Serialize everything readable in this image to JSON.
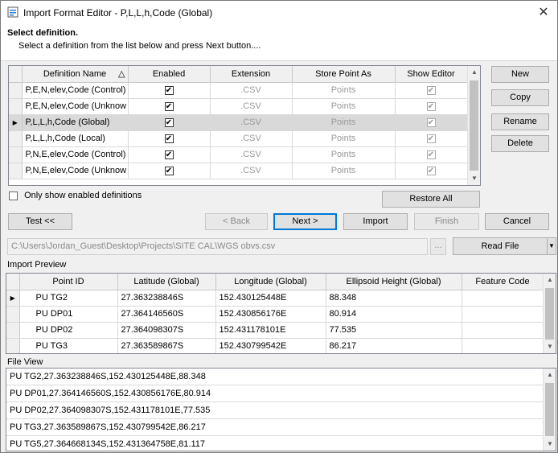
{
  "window": {
    "title": "Import Format Editor - P,L,L,h,Code (Global)",
    "close_glyph": "✕"
  },
  "header": {
    "title": "Select definition.",
    "subtitle": "Select a definition from the list below and press Next button...."
  },
  "definitions_grid": {
    "columns": [
      "Definition Name",
      "Enabled",
      "Extension",
      "Store Point As",
      "Show Editor"
    ],
    "sort_glyph": "△",
    "rows": [
      {
        "name": "P,E,N,elev,Code (Control)",
        "enabled": true,
        "extension": ".CSV",
        "store_as": "Points",
        "show_editor": true
      },
      {
        "name": "P,E,N,elev,Code (Unknow",
        "enabled": true,
        "extension": ".CSV",
        "store_as": "Points",
        "show_editor": true
      },
      {
        "name": "P,L,L,h,Code (Global)",
        "enabled": true,
        "extension": ".CSV",
        "store_as": "Points",
        "show_editor": true
      },
      {
        "name": "P,L,L,h,Code (Local)",
        "enabled": true,
        "extension": ".CSV",
        "store_as": "Points",
        "show_editor": true
      },
      {
        "name": "P,N,E,elev,Code (Control)",
        "enabled": true,
        "extension": ".CSV",
        "store_as": "Points",
        "show_editor": true
      },
      {
        "name": "P,N,E,elev,Code (Unknow",
        "enabled": true,
        "extension": ".CSV",
        "store_as": "Points",
        "show_editor": true
      }
    ],
    "selected_row_index": 2
  },
  "side_buttons": {
    "new": "New",
    "copy": "Copy",
    "rename": "Rename",
    "delete": "Delete"
  },
  "only_enabled_label": "Only show enabled definitions",
  "restore_all": "Restore All",
  "nav_buttons": {
    "test": "Test <<",
    "back": "< Back",
    "next": "Next >",
    "import": "Import",
    "finish": "Finish",
    "cancel": "Cancel"
  },
  "file_path": {
    "value": "C:\\Users\\Jordan_Guest\\Desktop\\Projects\\SITE CAL\\WGS obvs.csv",
    "browse": "..."
  },
  "read_file": {
    "label": "Read File",
    "drop_glyph": "▼"
  },
  "import_preview": {
    "label": "Import Preview",
    "columns": [
      "Point ID",
      "Latitude (Global)",
      "Longitude (Global)",
      "Ellipsoid Height (Global)",
      "Feature Code"
    ],
    "rows": [
      [
        "PU TG2",
        "27.363238846S",
        "152.430125448E",
        "88.348",
        ""
      ],
      [
        "PU DP01",
        "27.364146560S",
        "152.430856176E",
        "80.914",
        ""
      ],
      [
        "PU DP02",
        "27.364098307S",
        "152.431178101E",
        "77.535",
        ""
      ],
      [
        "PU TG3",
        "27.363589867S",
        "152.430799542E",
        "86.217",
        ""
      ]
    ]
  },
  "file_view": {
    "label": "File View",
    "lines": [
      "PU TG2,27.363238846S,152.430125448E,88.348",
      "PU DP01,27.364146560S,152.430856176E,80.914",
      "PU DP02,27.364098307S,152.431178101E,77.535",
      "PU TG3,27.363589867S,152.430799542E,86.217",
      "PU TG5,27.364668134S,152.431364758E,81.117"
    ]
  },
  "scroll_glyphs": {
    "up": "▲",
    "down": "▼"
  },
  "checkmark": "✔",
  "row_pointer": "▶"
}
